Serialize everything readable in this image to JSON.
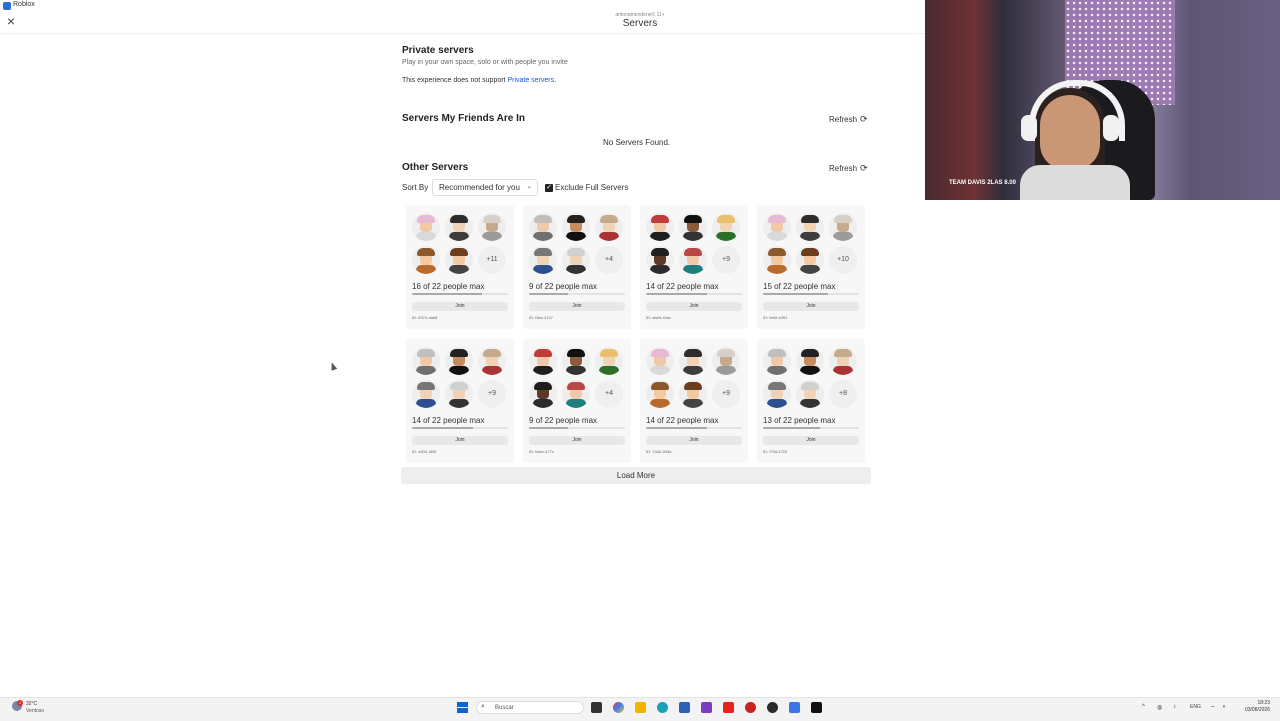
{
  "window": {
    "title": "Roblox"
  },
  "header": {
    "subtitle": "antonamenderie© 11+",
    "title": "Servers"
  },
  "private": {
    "title": "Private servers",
    "desc": "Play in your own space, solo or with people you invite",
    "note_prefix": "This experience does not support ",
    "note_link": "Private servers",
    "note_suffix": "."
  },
  "friends": {
    "title": "Servers My Friends Are In",
    "refresh": "Refresh",
    "empty": "No Servers Found."
  },
  "other": {
    "title": "Other Servers",
    "refresh": "Refresh",
    "sort_label": "Sort By",
    "sort_value": "Recommended for you",
    "exclude_label": "Exclude Full Servers",
    "exclude_checked": true
  },
  "servers": [
    {
      "players": "16 of 22 people max",
      "more": "+11",
      "fill": 0.73,
      "join": "Join",
      "id": "ID: 8374-4ab8"
    },
    {
      "players": "9 of 22 people max",
      "more": "+4",
      "fill": 0.41,
      "join": "Join",
      "id": "ID: f3cb-4707"
    },
    {
      "players": "14 of 22 people max",
      "more": "+9",
      "fill": 0.64,
      "join": "Join",
      "id": "ID: abe5-444c"
    },
    {
      "players": "15 of 22 people max",
      "more": "+10",
      "fill": 0.68,
      "join": "Join",
      "id": "ID: 9e6f-4051"
    },
    {
      "players": "14 of 22 people max",
      "more": "+9",
      "fill": 0.64,
      "join": "Join",
      "id": "ID: a334-460f"
    },
    {
      "players": "9 of 22 people max",
      "more": "+4",
      "fill": 0.41,
      "join": "Join",
      "id": "ID: bbec-477c"
    },
    {
      "players": "14 of 22 people max",
      "more": "+9",
      "fill": 0.64,
      "join": "Join",
      "id": "ID: 74d2-403a"
    },
    {
      "players": "13 of 22 people max",
      "more": "+8",
      "fill": 0.59,
      "join": "Join",
      "id": "ID: 07fd-4720"
    }
  ],
  "load_more": "Load More",
  "webcam": {
    "caption": "TEAM DAVIS 2LAS 8.00"
  },
  "taskbar": {
    "temp": "32°C",
    "weather": "Ventoso",
    "search_placeholder": "Buscar",
    "lang": "ENG",
    "time": "18:23",
    "date": "03/08/2026"
  },
  "colors": {
    "link": "#1a56d6",
    "taskbar": "#f3f3f3",
    "windows_blue": "#0a64d6"
  }
}
